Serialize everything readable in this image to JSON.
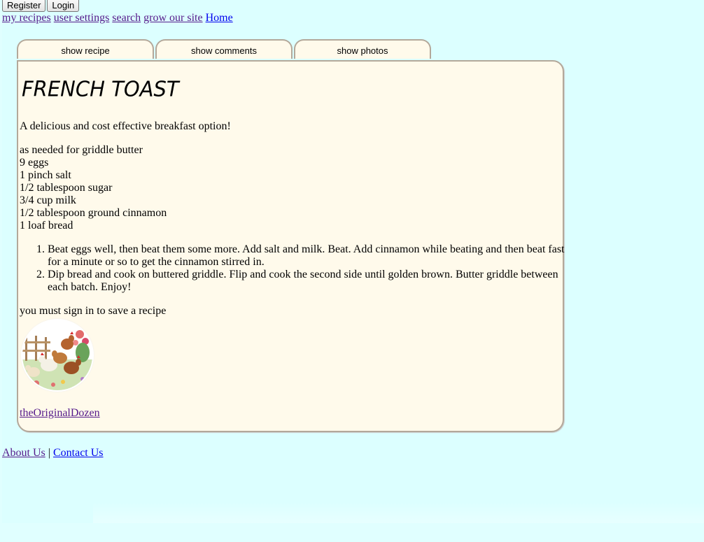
{
  "auth": {
    "register": "Register",
    "login": "Login"
  },
  "nav": {
    "my_recipes": "my recipes",
    "user_settings": "user settings",
    "search": "search",
    "grow": "grow our site",
    "home": "Home"
  },
  "tabs": [
    "show recipe",
    "show comments",
    "show photos"
  ],
  "recipe": {
    "title": "FRENCH TOAST",
    "description": "A delicious and cost effective breakfast option!",
    "ingredients": [
      "as needed for griddle butter",
      "9 eggs",
      "1 pinch salt",
      "1/2 tablespoon sugar",
      "3/4 cup milk",
      "1/2 tablespoon ground cinnamon",
      "1 loaf bread"
    ],
    "steps": [
      "Beat eggs well, then beat them some more. Add salt and milk. Beat. Add cinnamon while beating and then beat fast for a minute or so to get the cinnamon stirred in.",
      "Dip bread and cook on buttered griddle. Flip and cook the second side until golden brown. Butter griddle between each batch. Enjoy!"
    ],
    "signin_note": "you must sign in to save a recipe",
    "author": "theOriginalDozen"
  },
  "footer": {
    "about": "About Us",
    "separator": "|",
    "contact": "Contact Us"
  },
  "colors": {
    "page_bg": "#dcffff",
    "card_bg": "#fffaeb",
    "border": "#b3a89a",
    "visited_link": "#551a8b",
    "link": "#0000ee"
  }
}
